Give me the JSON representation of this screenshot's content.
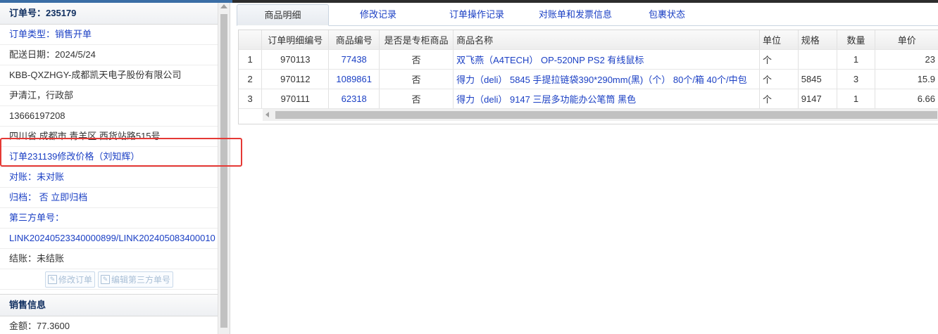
{
  "order": {
    "header": "订单号：235179",
    "type": "订单类型：销售开单",
    "delivery_date": "配送日期：2024/5/24",
    "customer": "KBB-QXZHGY-成都凯天电子股份有限公司",
    "contact": "尹清江，行政部",
    "phone": "13666197208",
    "address": "四川省 成都市 青羊区 西货站路515号",
    "price_change": "订单231139修改价格（刘知辉）",
    "reconcile": "对账：未对账",
    "archive_label": "归档：",
    "archive_value": "否",
    "archive_action": "立即归档",
    "third_party_label": "第三方单号：",
    "third_party_value": "LINK20240523340000899/LINK202405083400010",
    "settle": "结账：未结账",
    "btn_edit_order": "修改订单",
    "btn_edit_third": "编辑第三方单号",
    "sales_header": "销售信息",
    "amount": "金额：77.3600"
  },
  "tabs": [
    {
      "label": "商品明细"
    },
    {
      "label": "修改记录"
    },
    {
      "label": "订单操作记录"
    },
    {
      "label": "对账单和发票信息"
    },
    {
      "label": "包裹状态"
    }
  ],
  "table": {
    "headers": [
      "订单明细编号",
      "商品编号",
      "是否是专柜商品",
      "商品名称",
      "单位",
      "规格",
      "数量",
      "单价"
    ],
    "rows": [
      {
        "idx": "1",
        "detail_id": "970113",
        "product_id": "77438",
        "counter": "否",
        "name": "双飞燕（A4TECH） OP-520NP PS2 有线鼠标",
        "unit": "个",
        "spec": "",
        "qty": "1",
        "price": "23"
      },
      {
        "idx": "2",
        "detail_id": "970112",
        "product_id": "1089861",
        "counter": "否",
        "name": "得力（deli） 5845 手提拉链袋390*290mm(黑)（个） 80个/箱 40个/中包",
        "unit": "个",
        "spec": "5845",
        "qty": "3",
        "price": "15.9"
      },
      {
        "idx": "3",
        "detail_id": "970111",
        "product_id": "62318",
        "counter": "否",
        "name": "得力（deli） 9147 三层多功能办公笔筒 黑色",
        "unit": "个",
        "spec": "9147",
        "qty": "1",
        "price": "6.66"
      }
    ]
  },
  "colors": {
    "link": "#1a3fc4",
    "highlight": "#e53935",
    "header_text": "#0e2d5f"
  }
}
